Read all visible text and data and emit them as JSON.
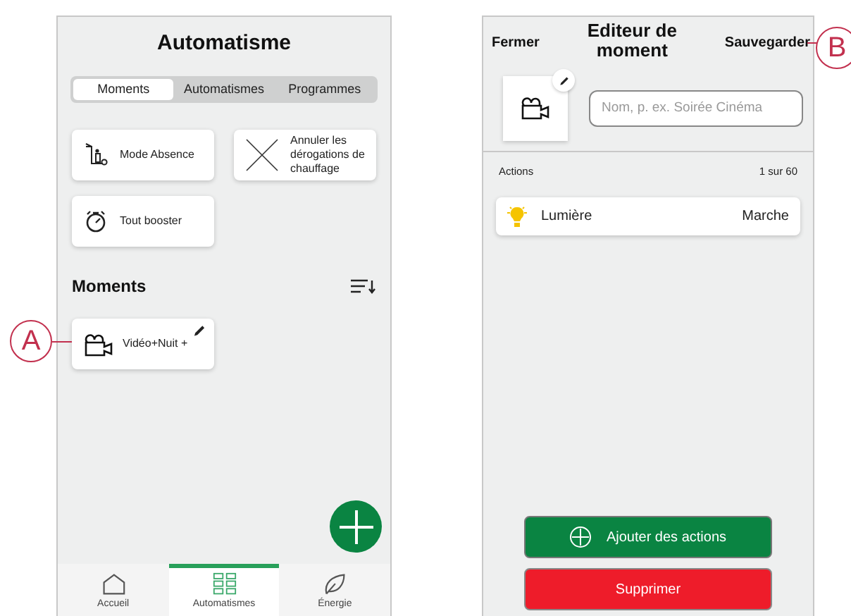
{
  "callouts": [
    {
      "label": "A"
    },
    {
      "label": "B"
    }
  ],
  "automation_screen": {
    "title": "Automatisme",
    "tabs": [
      {
        "label": "Moments",
        "selected": true
      },
      {
        "label": "Automatismes",
        "selected": false
      },
      {
        "label": "Programmes",
        "selected": false
      }
    ],
    "quick_actions": [
      {
        "kind": "away",
        "label": "Mode Absence"
      },
      {
        "kind": "cancel",
        "label": "Annuler les dérogations de chauffage"
      },
      {
        "kind": "timer",
        "label": "Tout booster"
      }
    ],
    "moments_heading": "Moments",
    "moments": [
      {
        "label": "Vidéo+Nuit +"
      }
    ],
    "bottom_nav": [
      {
        "kind": "home",
        "label": "Accueil",
        "selected": false
      },
      {
        "kind": "grid",
        "label": "Automatismes",
        "selected": true
      },
      {
        "kind": "leaf",
        "label": "Énergie",
        "selected": false
      }
    ]
  },
  "editor_screen": {
    "close": "Fermer",
    "title": "Editeur de moment",
    "save": "Sauvegarder",
    "name_field": {
      "placeholder": "Nom, p. ex. Soirée Cinéma"
    },
    "actions_label": "Actions",
    "actions_count": "1 sur 60",
    "actions": [
      {
        "name": "Lumière",
        "value": "Marche"
      }
    ],
    "add_button": "Ajouter des actions",
    "delete_button": "Supprimer"
  }
}
